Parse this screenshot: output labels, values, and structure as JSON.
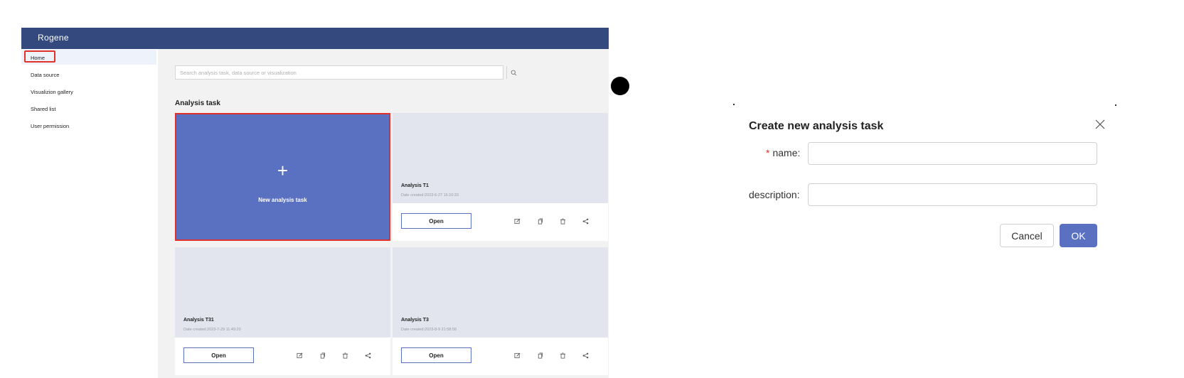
{
  "app": {
    "logo": "Rogene",
    "sidebar": {
      "items": [
        {
          "label": "Home"
        },
        {
          "label": "Data source"
        },
        {
          "label": "Visualizion gallery"
        },
        {
          "label": "Shared list"
        },
        {
          "label": "User permission"
        }
      ]
    },
    "search": {
      "placeholder": "Search analysis task, data source or visualization"
    },
    "section_title": "Analysis task",
    "new_card": {
      "icon": "+",
      "label": "New analysis task"
    },
    "cards": [
      {
        "name": "Analysis T1",
        "date": "Date created:2023-6-27 16:10:33",
        "open_label": "Open"
      },
      {
        "name": "Analysis T31",
        "date": "Date created:2023-7-29 11:49:20",
        "open_label": "Open"
      },
      {
        "name": "Analysis T3",
        "date": "Date created:2023-8-9 21:58:58",
        "open_label": "Open"
      }
    ],
    "colors": {
      "topbar": "#344a7e",
      "accent": "#5a71c1",
      "highlight": "#e0312a"
    }
  },
  "dialog": {
    "title": "Create new analysis task",
    "required_mark": "*",
    "name_label": "name:",
    "description_label": "description:",
    "cancel_label": "Cancel",
    "ok_label": "OK"
  }
}
